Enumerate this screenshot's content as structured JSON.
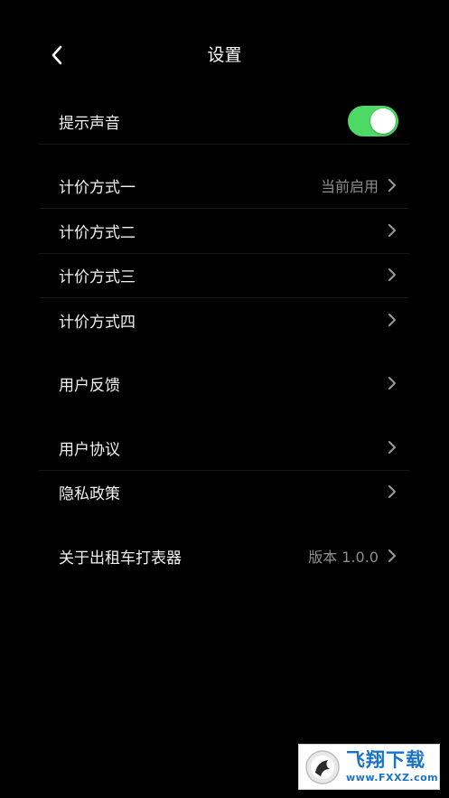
{
  "header": {
    "title": "设置",
    "back_icon": "chevron-left-icon"
  },
  "sound_toggle": {
    "label": "提示声音",
    "on": true,
    "on_color": "#4cd964"
  },
  "pricing": [
    {
      "label": "计价方式一",
      "value": "当前启用"
    },
    {
      "label": "计价方式二",
      "value": ""
    },
    {
      "label": "计价方式三",
      "value": ""
    },
    {
      "label": "计价方式四",
      "value": ""
    }
  ],
  "feedback": {
    "label": "用户反馈"
  },
  "agreement": {
    "label": "用户协议"
  },
  "privacy": {
    "label": "隐私政策"
  },
  "about": {
    "label": "关于出租车打表器",
    "value": "版本 1.0.0"
  },
  "watermark": {
    "brand": "飞翔下载",
    "url": "www.FXXZ.com"
  }
}
